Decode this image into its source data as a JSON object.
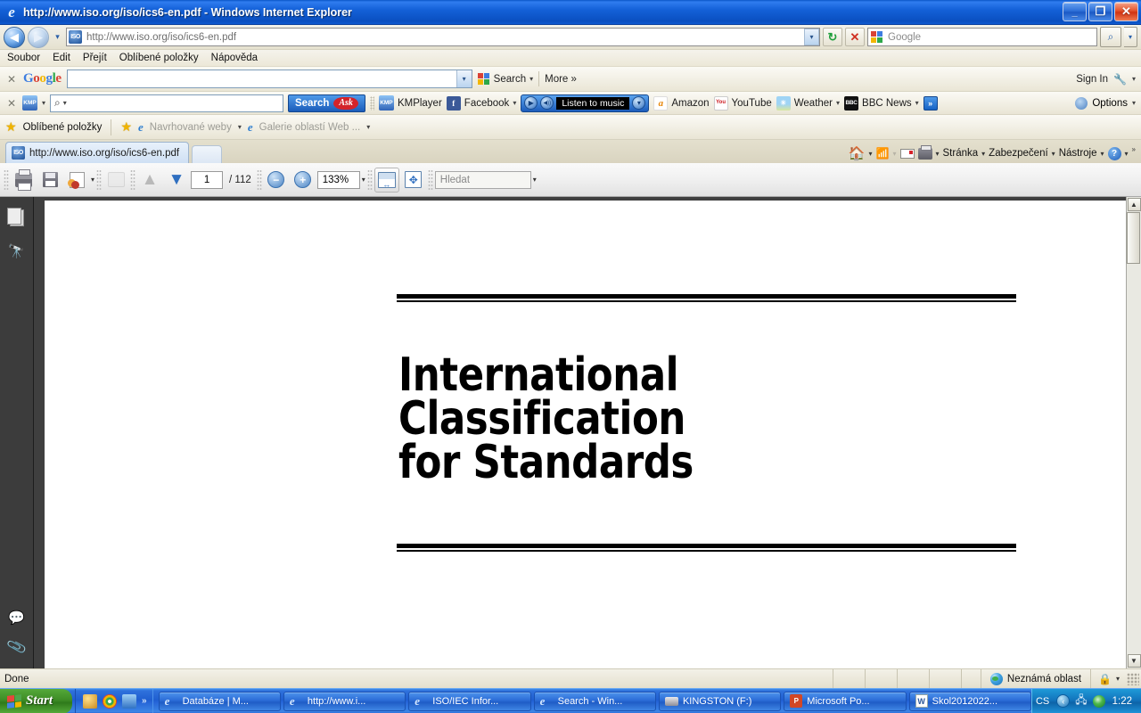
{
  "window": {
    "title": "http://www.iso.org/iso/ics6-en.pdf - Windows Internet Explorer",
    "app_icon": "ie-logo-icon",
    "minimize_label": "_",
    "maximize_label": "❐",
    "close_label": "✕"
  },
  "address_bar": {
    "back_label": "◀",
    "forward_label": "▶",
    "history_label": "▾",
    "site_icon_label": "ISO",
    "url": "http://www.iso.org/iso/ics6-en.pdf",
    "url_dropdown_label": "▾",
    "refresh_label": "↻",
    "stop_label": "✕",
    "search_placeholder": "Google",
    "go_search_label": "⌕",
    "go_dropdown_label": "▾"
  },
  "menu": {
    "items": [
      "Soubor",
      "Edit",
      "Přejít",
      "Oblíbené položky",
      "Nápověda"
    ]
  },
  "google_toolbar": {
    "close_label": "✕",
    "logo": {
      "g1": "G",
      "o1": "o",
      "o2": "o",
      "g2": "g",
      "l": "l",
      "e": "e"
    },
    "input_value": "",
    "input_dropdown_label": "▾",
    "search_label": "Search",
    "search_caret": "▾",
    "more_label": "More",
    "more_chevron": "»",
    "signin_label": "Sign In",
    "wrench_icon": "🔧",
    "wrench_caret": "▾"
  },
  "ask_toolbar": {
    "close_label": "✕",
    "kmp_icon_label": "KMP",
    "kmp_caret": "▾",
    "search_icon": "⌕",
    "search_icon_caret": "▾",
    "input_value": "",
    "search_button_label": "Search",
    "ask_logo_label": "Ask",
    "items": [
      {
        "label": "KMPlayer",
        "icon": "kmplayer-icon",
        "caret": ""
      },
      {
        "label": "Facebook",
        "icon": "facebook-icon",
        "caret": "▾"
      }
    ],
    "music": {
      "play_label": "▶",
      "volume_label": "◀))",
      "text": "Listen to music",
      "dropdown_label": "▾"
    },
    "items2": [
      {
        "label": "Amazon",
        "icon": "amazon-icon",
        "caret": ""
      },
      {
        "label": "YouTube",
        "icon": "youtube-icon",
        "caret": ""
      },
      {
        "label": "Weather",
        "icon": "weather-icon",
        "caret": "▾"
      },
      {
        "label": "BBC News",
        "icon": "bbc-news-icon",
        "caret": "▾"
      }
    ],
    "overflow_label": "»",
    "options_label": "Options",
    "options_caret": "▾"
  },
  "favorites_bar": {
    "favorites_label": "Oblíbené položky",
    "add_icon": "add-favorite-icon",
    "items": [
      {
        "label": "Navrhované weby",
        "icon": "ie-icon",
        "caret": "▾"
      },
      {
        "label": "Galerie oblastí Web ...",
        "icon": "page-icon",
        "caret": "▾"
      }
    ]
  },
  "tabs": {
    "items": [
      {
        "label": "http://www.iso.org/iso/ics6-en.pdf",
        "icon": "iso-site-icon"
      }
    ],
    "new_tab_label": ""
  },
  "command_bar": {
    "home_label": "",
    "home_caret": "▾",
    "feeds_label": "",
    "feeds_caret": "▾",
    "mail_label": "",
    "mail_caret": "",
    "print_label": "",
    "print_caret": "▾",
    "page_label": "Stránka",
    "page_caret": "▾",
    "security_label": "Zabezpečení",
    "security_caret": "▾",
    "tools_label": "Nástroje",
    "tools_caret": "▾",
    "help_label": "?",
    "help_caret": "▾",
    "overflow_label": "»"
  },
  "pdf_toolbar": {
    "print_label": "",
    "save_label": "",
    "secure_label": "",
    "secure_caret": "▾",
    "web_label": "",
    "prev_page_label": "▲",
    "next_page_label": "▼",
    "page_number": "1",
    "page_total": "/ 112",
    "zoom_out_label": "−",
    "zoom_in_label": "+",
    "zoom_value": "133%",
    "zoom_caret": "▾",
    "fit_width_label": "",
    "fit_page_label": "",
    "find_placeholder": "Hledat",
    "find_caret": "▾"
  },
  "pdf_sidebar": {
    "items": [
      {
        "name": "pages-panel",
        "icon": "pages-icon"
      },
      {
        "name": "search-panel",
        "icon": "binoculars-icon"
      }
    ],
    "bottom_items": [
      {
        "name": "comments-panel",
        "icon": "comment-icon"
      },
      {
        "name": "attachments-panel",
        "icon": "paperclip-icon"
      }
    ]
  },
  "document": {
    "title_line1": "International",
    "title_line2": "Classification",
    "title_line3": "for Standards"
  },
  "scrollbar": {
    "up_label": "▲",
    "down_label": "▼"
  },
  "status_bar": {
    "status": "Done",
    "zone": "Neznámá oblast",
    "zone_icon": "globe-icon",
    "security_icon": "lock-icon",
    "security_caret": "▾"
  },
  "taskbar": {
    "start_label": "Start",
    "quicklaunch": [
      {
        "name": "quicklaunch-item-1",
        "icon": "app-icon"
      },
      {
        "name": "quicklaunch-item-2",
        "icon": "chrome-icon"
      },
      {
        "name": "quicklaunch-item-3",
        "icon": "media-icon"
      }
    ],
    "quicklaunch_overflow": "»",
    "tasks": [
      {
        "label": "Databáze | M...",
        "icon": "ie-icon"
      },
      {
        "label": "http://www.i...",
        "icon": "ie-icon"
      },
      {
        "label": "ISO/IEC Infor...",
        "icon": "ie-icon"
      },
      {
        "label": "Search - Win...",
        "icon": "ie-icon"
      },
      {
        "label": "KINGSTON (F:)",
        "icon": "usb-drive-icon"
      },
      {
        "label": "Microsoft Po...",
        "icon": "powerpoint-icon"
      },
      {
        "label": "Skol2012022...",
        "icon": "word-icon"
      }
    ],
    "language": "CS",
    "tray_chevron": "‹",
    "clock": "1:22"
  },
  "colors": {
    "titlebar_blue": "#1461d8",
    "taskbar_blue": "#2463d6",
    "start_green": "#3d8c25",
    "accent_orange": "#f0b400"
  }
}
